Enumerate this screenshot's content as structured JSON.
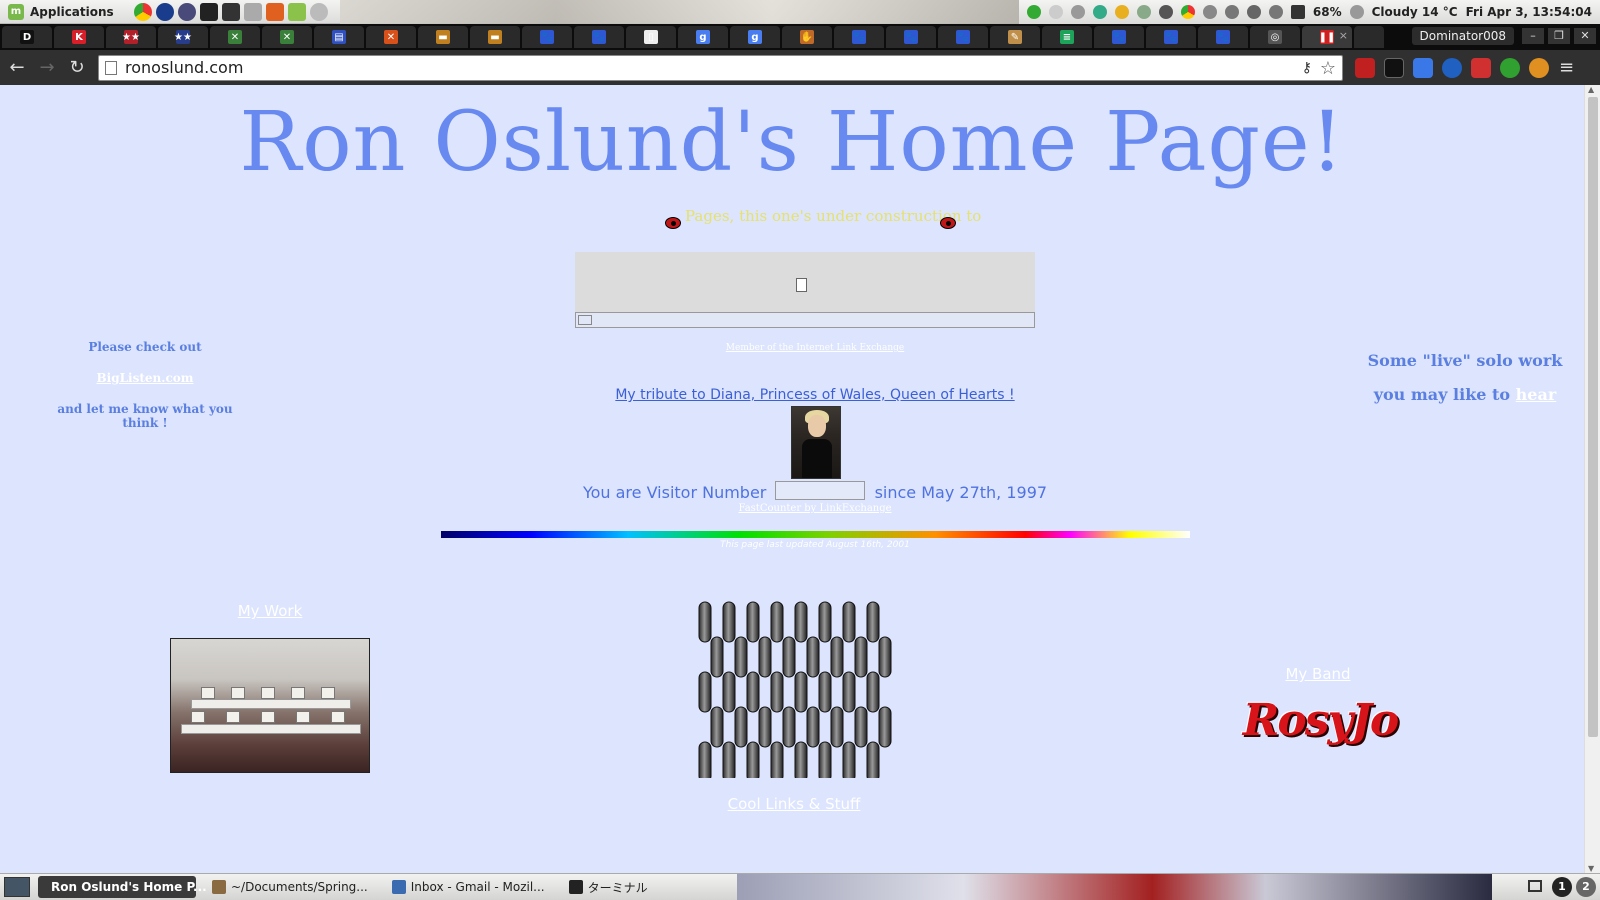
{
  "system_panel": {
    "menu_label": "Applications",
    "battery": "68%",
    "weather": "Cloudy 14 °C",
    "clock": "Fri Apr  3, 13:54:04"
  },
  "browser": {
    "profile_name": "Dominator008",
    "tabs": [
      {
        "favicon": "D",
        "color": "#111111"
      },
      {
        "favicon": "K",
        "color": "#d81e28"
      },
      {
        "favicon": "★★",
        "color": "#b2202a"
      },
      {
        "favicon": "★★",
        "color": "#283c8c"
      },
      {
        "favicon": "✕",
        "color": "#3a7f3a"
      },
      {
        "favicon": "✕",
        "color": "#3a7f3a"
      },
      {
        "favicon": "▤",
        "color": "#3050c0"
      },
      {
        "favicon": "✕",
        "color": "#d8501a"
      },
      {
        "favicon": "▬",
        "color": "#c08020"
      },
      {
        "favicon": "▬",
        "color": "#c08020"
      },
      {
        "favicon": "🐾",
        "color": "#2f56d3"
      },
      {
        "favicon": "🐾",
        "color": "#2f56d3"
      },
      {
        "favicon": "▯",
        "color": "#eeeeee"
      },
      {
        "favicon": "g",
        "color": "#4a7ef0"
      },
      {
        "favicon": "g",
        "color": "#4a7ef0"
      },
      {
        "favicon": "✋",
        "color": "#c06a2a"
      },
      {
        "favicon": "🐾",
        "color": "#2f56d3"
      },
      {
        "favicon": "🐾",
        "color": "#2f56d3"
      },
      {
        "favicon": "🐾",
        "color": "#2f56d3"
      },
      {
        "favicon": "✎",
        "color": "#c0904a"
      },
      {
        "favicon": "≡",
        "color": "#1ea35a"
      },
      {
        "favicon": "🐾",
        "color": "#2f56d3"
      },
      {
        "favicon": "🐾",
        "color": "#2f56d3"
      },
      {
        "favicon": "🐾",
        "color": "#2f56d3"
      },
      {
        "favicon": "◎",
        "color": "#555555"
      },
      {
        "favicon": "❚❚",
        "color": "#d02020"
      }
    ],
    "url": "ronoslund.com"
  },
  "page": {
    "title": "Ron Oslund's Home Page!",
    "construction_text": "Pages, this one's under construction to",
    "link_exchange": "Member of the Internet Link Exchange",
    "left_promo": {
      "line1": "Please check out",
      "link": "BigListen.com",
      "line2": "and let me know what you think !"
    },
    "right_promo": {
      "line1": "Some \"live\" solo work",
      "line2": "you may like to",
      "link": "hear"
    },
    "diana_link": "My tribute to Diana, Princess of Wales, Queen of Hearts !",
    "visitor_prefix": "You are Visitor Number",
    "visitor_suffix": "since May 27th, 1997",
    "fastcounter": "FastCounter by LinkExchange",
    "updated": "This page last updated August 16th, 2001",
    "my_work": "My Work",
    "cool_links": "Cool Links & Stuff",
    "my_band": "My Band",
    "band_logo": "RosyJo"
  },
  "taskbar": {
    "tasks": [
      {
        "label": "Ron Oslund's Home P...",
        "active": true
      },
      {
        "label": "~/Documents/Spring...",
        "active": false
      },
      {
        "label": "Inbox - Gmail - Mozil...",
        "active": false
      },
      {
        "label": "ターミナル",
        "active": false
      }
    ],
    "workspaces": [
      "1",
      "2"
    ]
  },
  "colors": {
    "page_background": "#dce4fe",
    "title_blue": "#6789f0",
    "link_white": "#ffffff"
  }
}
